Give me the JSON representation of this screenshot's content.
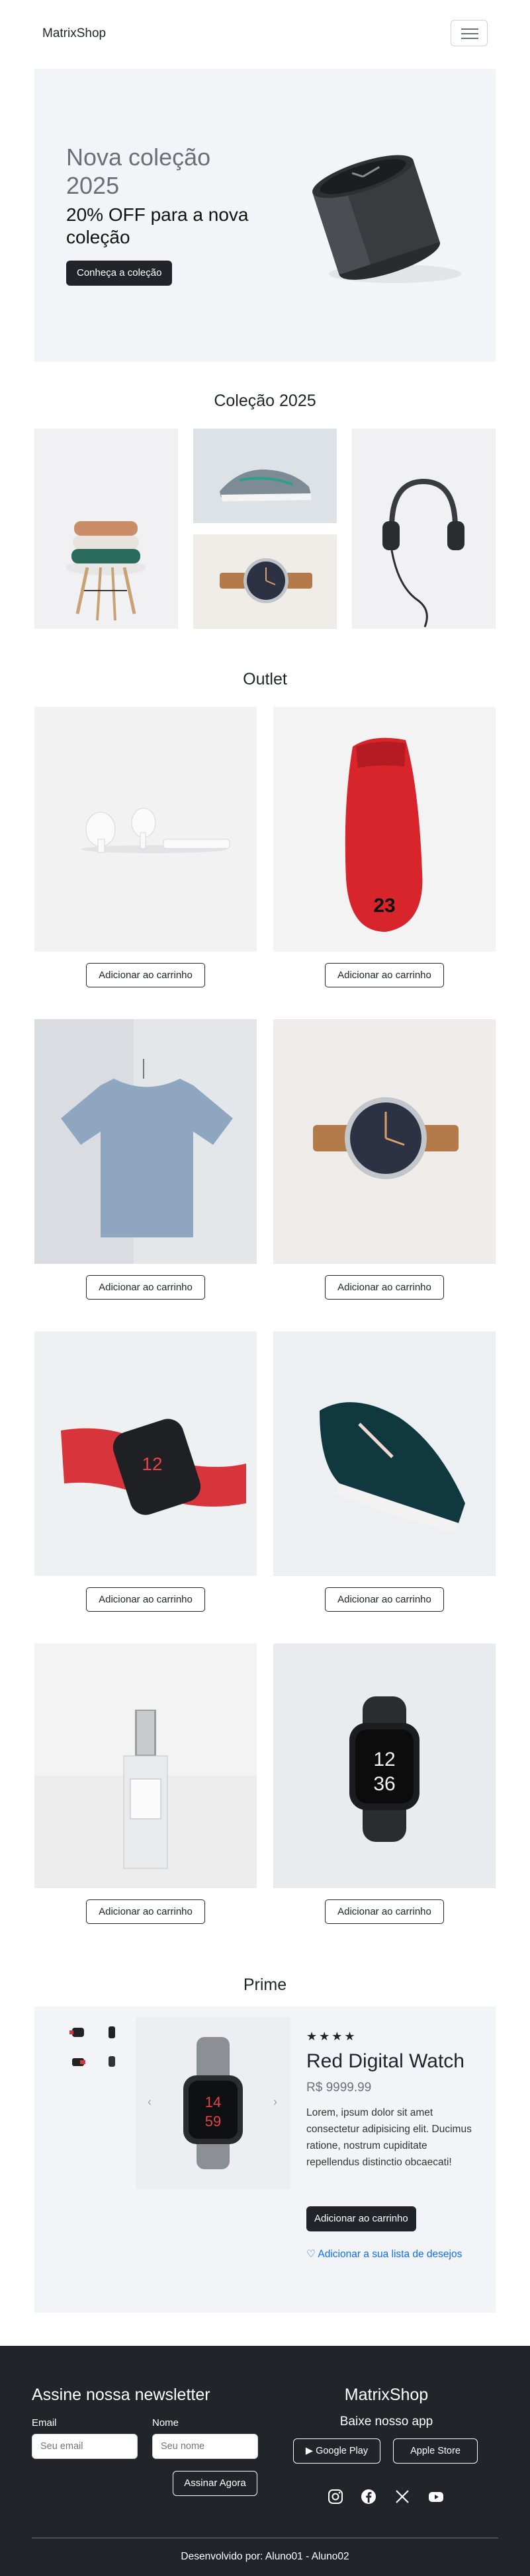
{
  "navbar": {
    "brand": "MatrixShop",
    "toggle_icon": "hamburger-menu-icon"
  },
  "hero": {
    "title": "Nova coleção 2025",
    "subtitle": "20% OFF para a nova coleção",
    "button_label": "Conheça a coleção",
    "image_icon": "table-clock-image"
  },
  "collection": {
    "title": "Coleção 2025",
    "images": [
      "folded-sweaters-image",
      "sneaker-image",
      "wristwatch-image",
      "headphones-image"
    ]
  },
  "outlet": {
    "title": "Outlet",
    "products": [
      {
        "image": "airpods-image",
        "button": "Adicionar ao carrinho"
      },
      {
        "image": "red-sneaker-image",
        "button": "Adicionar ao carrinho"
      },
      {
        "image": "tshirt-image",
        "button": "Adicionar ao carrinho"
      },
      {
        "image": "wristwatch-image",
        "button": "Adicionar ao carrinho"
      },
      {
        "image": "red-smartwatch-image",
        "button": "Adicionar ao carrinho"
      },
      {
        "image": "teal-sneaker-image",
        "button": "Adicionar ao carrinho"
      },
      {
        "image": "perfume-bottle-image",
        "button": "Adicionar ao carrinho"
      },
      {
        "image": "black-smartwatch-image",
        "button": "Adicionar ao carrinho"
      }
    ]
  },
  "prime": {
    "title": "Prime",
    "rating": "★★★★",
    "product_name": "Red Digital Watch",
    "price": "R$ 9999.99",
    "description": "Lorem, ipsum dolor sit amet consectetur adipisicing elit. Ducimus ratione, nostrum cupiditate repellendus distinctio obcaecati!",
    "cart_button": "Adicionar ao carrinho",
    "wishlist_link": "Adicionar a sua lista de desejos",
    "wishlist_icon": "heart-icon"
  },
  "footer": {
    "newsletter_title": "Assine nossa newsletter",
    "email_label": "Email",
    "email_placeholder": "Seu email",
    "name_label": "Nome",
    "name_placeholder": "Seu nome",
    "subscribe_button": "Assinar Agora",
    "brand": "MatrixShop",
    "app_title": "Baixe nosso app",
    "google_play": "Google Play",
    "apple_store": "Apple Store",
    "social_icons": [
      "instagram-icon",
      "facebook-icon",
      "x-twitter-icon",
      "youtube-icon"
    ],
    "credits": "Desenvolvido por: Aluno01 - Aluno02"
  },
  "colors": {
    "dark": "#212529",
    "panel": "#f3f4f7",
    "link": "#0d6efd"
  }
}
